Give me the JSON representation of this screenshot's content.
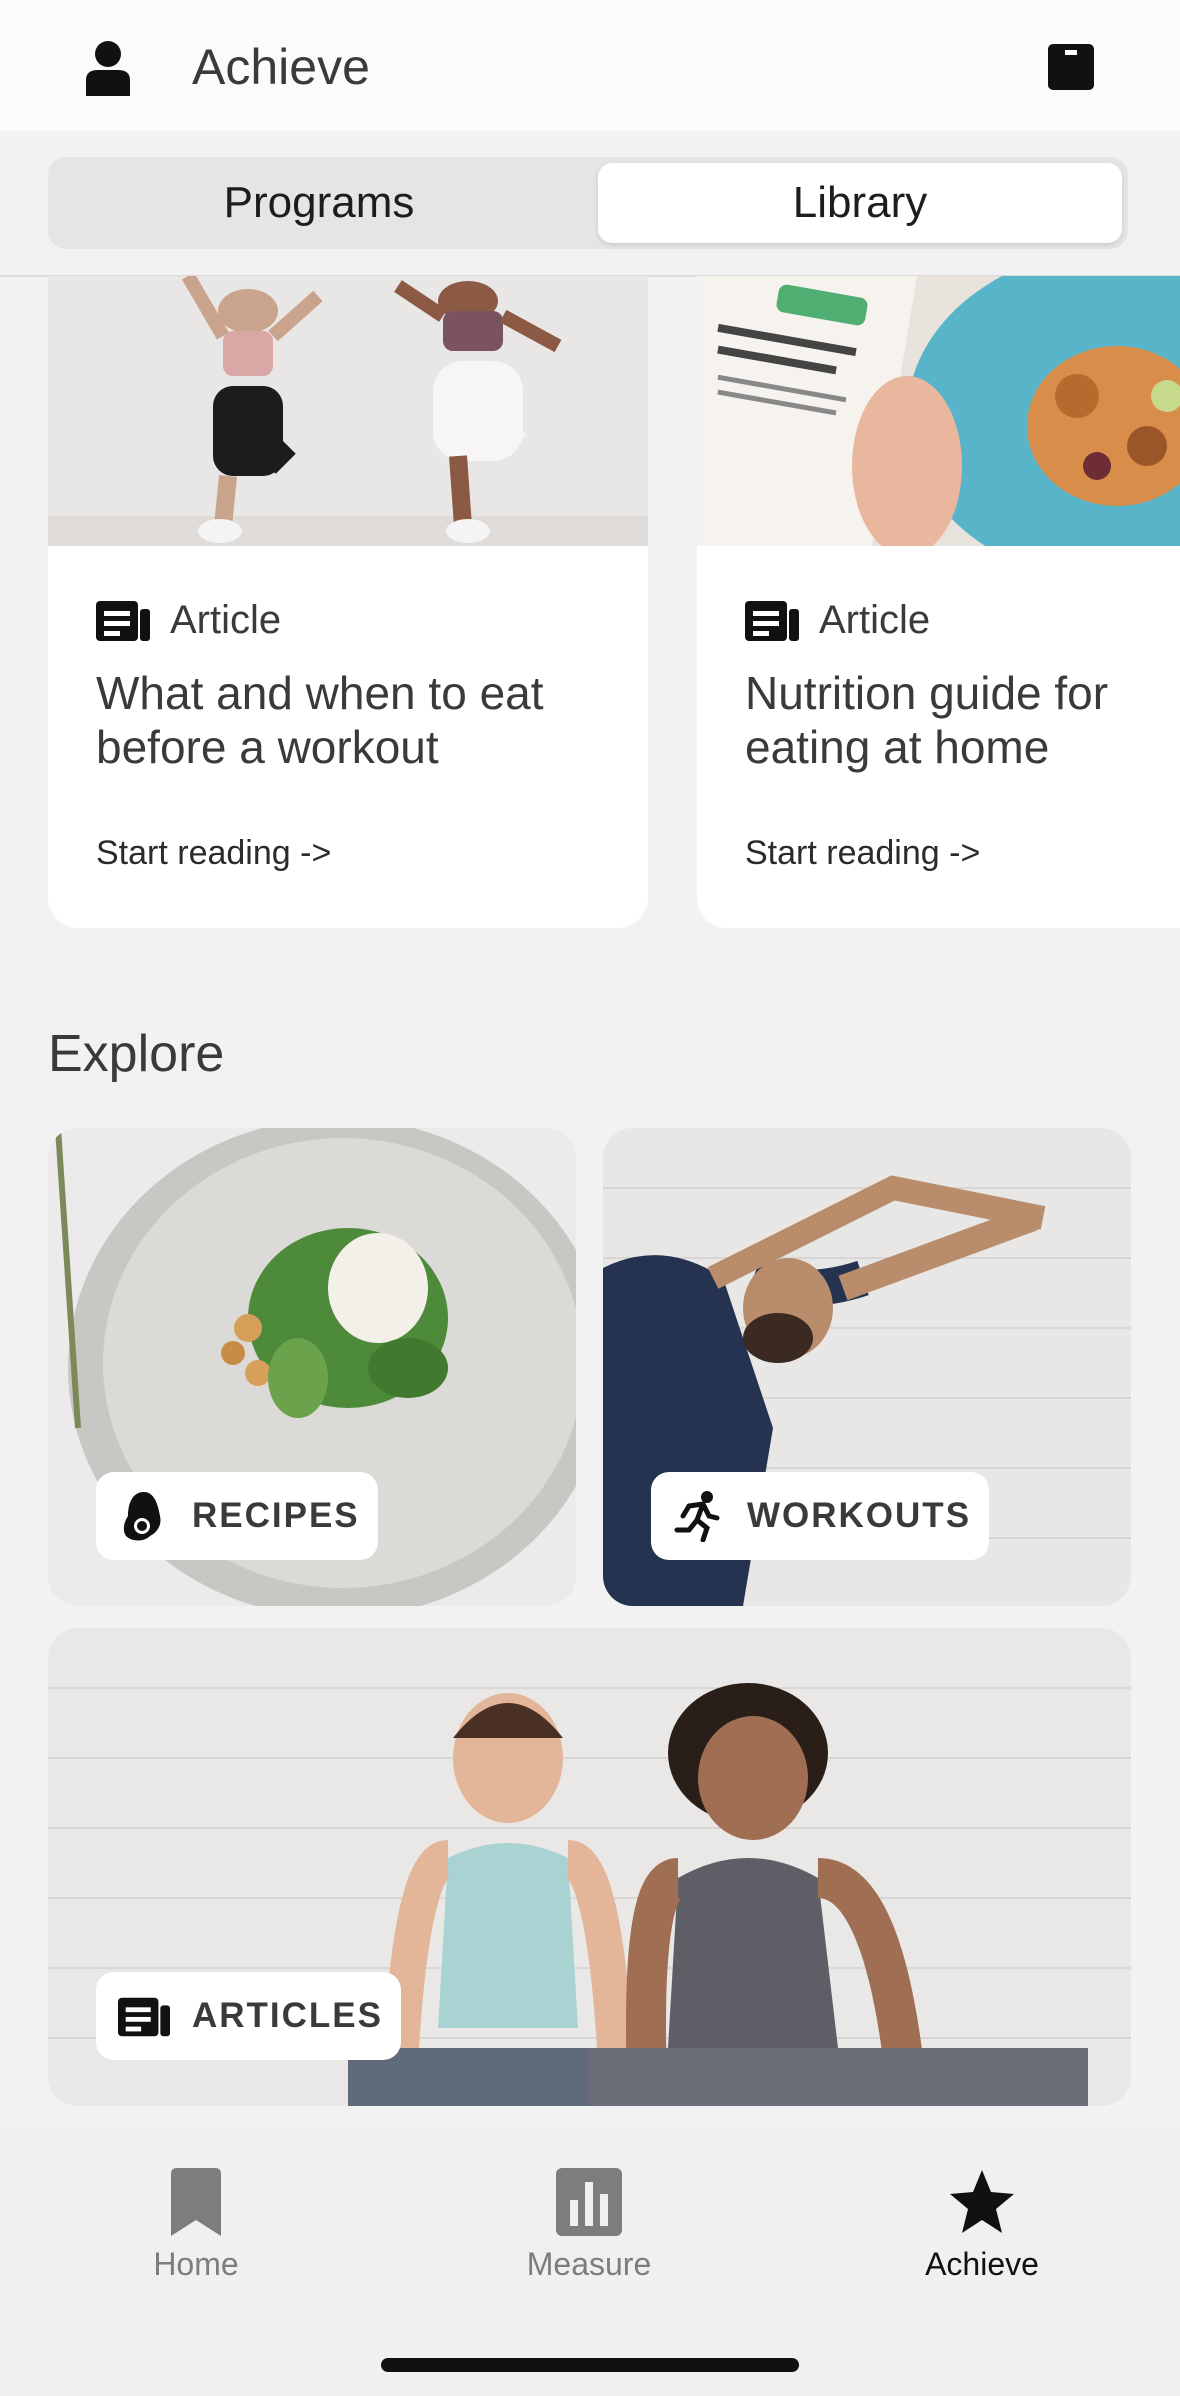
{
  "header": {
    "title": "Achieve",
    "left_icon": "profile-icon",
    "right_icon": "book-icon"
  },
  "segmented": {
    "programs_label": "Programs",
    "library_label": "Library",
    "selected": "Library"
  },
  "articles": [
    {
      "kind": "Article",
      "title": "What and when to eat before a workout",
      "cta": "Start reading ->",
      "image": "two-women-exercising-photo"
    },
    {
      "kind": "Article",
      "title": "Nutrition guide for eating at home",
      "cta": "Start reading ->",
      "image": "phone-and-food-plate-photo"
    }
  ],
  "explore": {
    "title": "Explore",
    "tiles": [
      {
        "label": "RECIPES",
        "icon": "avocado-icon",
        "image": "salad-bowl-photo"
      },
      {
        "label": "WORKOUTS",
        "icon": "running-icon",
        "image": "man-stretching-photo"
      },
      {
        "label": "ARTICLES",
        "icon": "article-icon",
        "image": "two-women-sitting-photo"
      }
    ]
  },
  "nav": {
    "items": [
      {
        "label": "Home",
        "icon": "bookmark-icon"
      },
      {
        "label": "Measure",
        "icon": "bar-chart-icon"
      },
      {
        "label": "Achieve",
        "icon": "star-icon"
      }
    ],
    "active": "Achieve"
  },
  "colors": {
    "background": "#f3f2f2",
    "card": "#ffffff",
    "text": "#3a3a3a",
    "nav_inactive": "#7d7d7d",
    "nav_active": "#111111"
  }
}
